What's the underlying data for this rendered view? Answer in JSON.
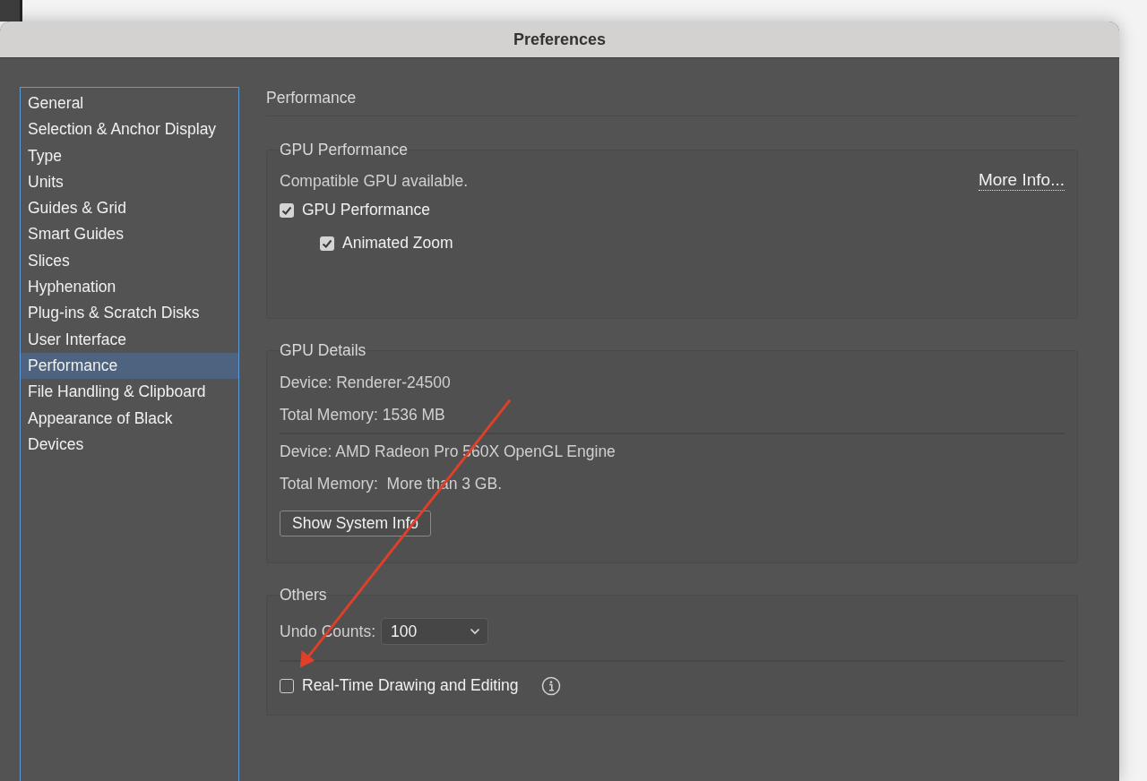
{
  "window": {
    "title": "Preferences"
  },
  "sidebar": {
    "items": [
      {
        "label": "General",
        "selected": false
      },
      {
        "label": "Selection & Anchor Display",
        "selected": false
      },
      {
        "label": "Type",
        "selected": false
      },
      {
        "label": "Units",
        "selected": false
      },
      {
        "label": "Guides & Grid",
        "selected": false
      },
      {
        "label": "Smart Guides",
        "selected": false
      },
      {
        "label": "Slices",
        "selected": false
      },
      {
        "label": "Hyphenation",
        "selected": false
      },
      {
        "label": "Plug-ins & Scratch Disks",
        "selected": false
      },
      {
        "label": "User Interface",
        "selected": false
      },
      {
        "label": "Performance",
        "selected": true
      },
      {
        "label": "File Handling & Clipboard",
        "selected": false
      },
      {
        "label": "Appearance of Black",
        "selected": false
      },
      {
        "label": "Devices",
        "selected": false
      }
    ]
  },
  "panel": {
    "title": "Performance",
    "gpu_performance": {
      "title": "GPU Performance",
      "status": "Compatible GPU available.",
      "link": "More Info...",
      "options": [
        {
          "label": "GPU Performance",
          "checked": true,
          "children": [
            {
              "label": "Animated Zoom",
              "checked": true
            }
          ]
        }
      ]
    },
    "gpu_details": {
      "title": "GPU Details",
      "devices": [
        {
          "device": "Device: Renderer-24500",
          "memory": "Total Memory: 1536 MB"
        },
        {
          "device": "Device: AMD Radeon Pro 560X OpenGL Engine",
          "memory": "Total Memory:  More than 3 GB."
        }
      ],
      "button": "Show System Info"
    },
    "others": {
      "title": "Others",
      "undo_label": "Undo Counts:",
      "undo_value": "100",
      "options": [
        {
          "label": "Real-Time Drawing and Editing",
          "checked": false
        }
      ]
    }
  }
}
